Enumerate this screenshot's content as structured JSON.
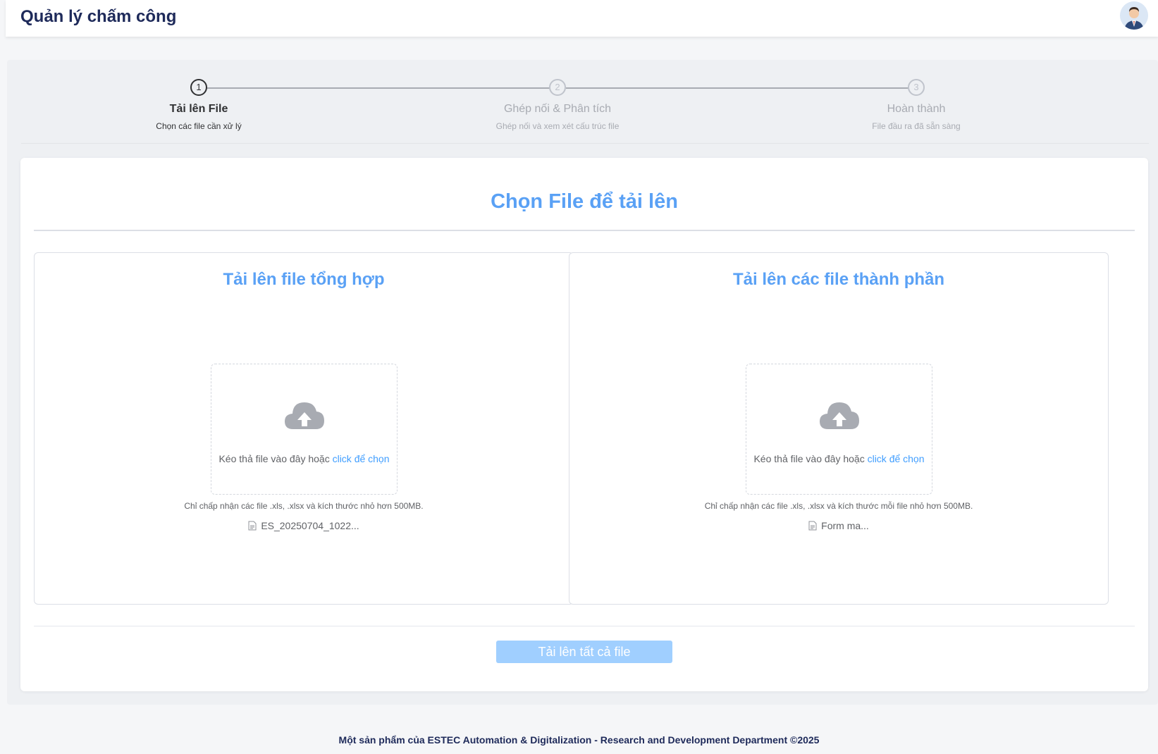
{
  "header": {
    "title": "Quản lý chấm công",
    "avatar_icon": "user-avatar-icon"
  },
  "steps": [
    {
      "number": "1",
      "label": "Tải lên File",
      "description": "Chọn các file cần xử lý",
      "active": true
    },
    {
      "number": "2",
      "label": "Ghép nối & Phân tích",
      "description": "Ghép nối và xem xét cấu trúc file",
      "active": false
    },
    {
      "number": "3",
      "label": "Hoàn thành",
      "description": "File đầu ra đã sẵn sàng",
      "active": false
    }
  ],
  "card": {
    "title": "Chọn File để tải lên"
  },
  "panels": {
    "summary": {
      "title": "Tải lên file tổng hợp",
      "hint_text": "Kéo thả file vào đây hoặc ",
      "hint_link": "click để chọn",
      "accept_text": "Chỉ chấp nhận các file .xls, .xlsx và kích thước nhỏ hơn 500MB.",
      "file_name": "ES_20250704_1022..."
    },
    "components": {
      "title": "Tải lên các file thành phần",
      "hint_text": "Kéo thả file vào đây hoặc ",
      "hint_link": "click để chọn",
      "accept_text": "Chỉ chấp nhận các file .xls, .xlsx và kích thước mỗi file nhỏ hơn 500MB.",
      "file_name": "Form ma..."
    }
  },
  "actions": {
    "upload_all_label": "Tải lên tất cả file"
  },
  "footer": {
    "text": "Một sản phẩm của ESTEC Automation & Digitalization - Research and Development Department ©2025"
  },
  "colors": {
    "accent": "#5aa1f5",
    "link": "#409eff",
    "button_disabled": "#a0cfff",
    "header_text": "#1e2a5a"
  }
}
